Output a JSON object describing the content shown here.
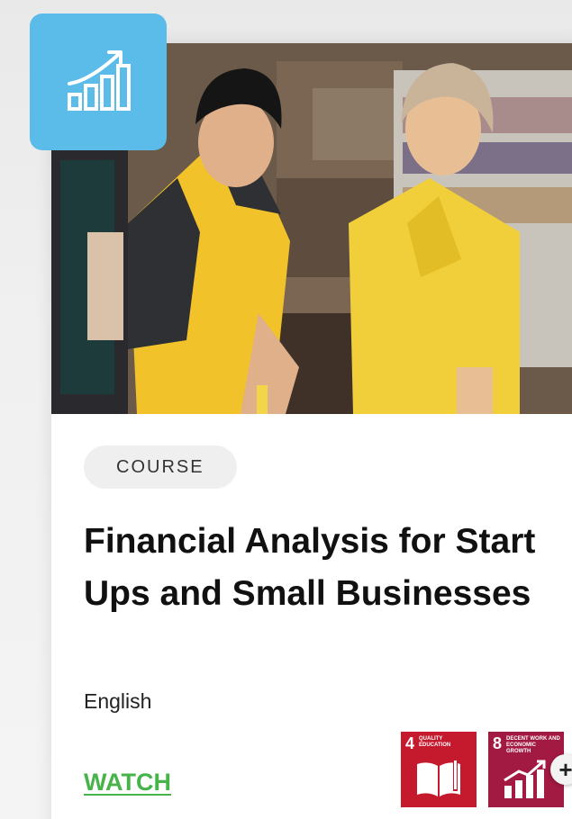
{
  "card": {
    "category_badge": "COURSE",
    "title": "Financial Analysis for Start Ups and Small Businesses",
    "language": "English",
    "watch_link": "WATCH",
    "category_icon": "growth-chart-icon",
    "more_button": "+"
  },
  "sdg_badges": [
    {
      "number": "4",
      "label": "QUALITY EDUCATION",
      "icon": "book-icon",
      "color": "#c5192d"
    },
    {
      "number": "8",
      "label": "DECENT WORK AND ECONOMIC GROWTH",
      "icon": "growth-chart-icon",
      "color": "#a21942"
    }
  ],
  "colors": {
    "icon_tile": "#5bbbe9",
    "watch_link": "#47b449",
    "badge_bg": "#efefef"
  }
}
